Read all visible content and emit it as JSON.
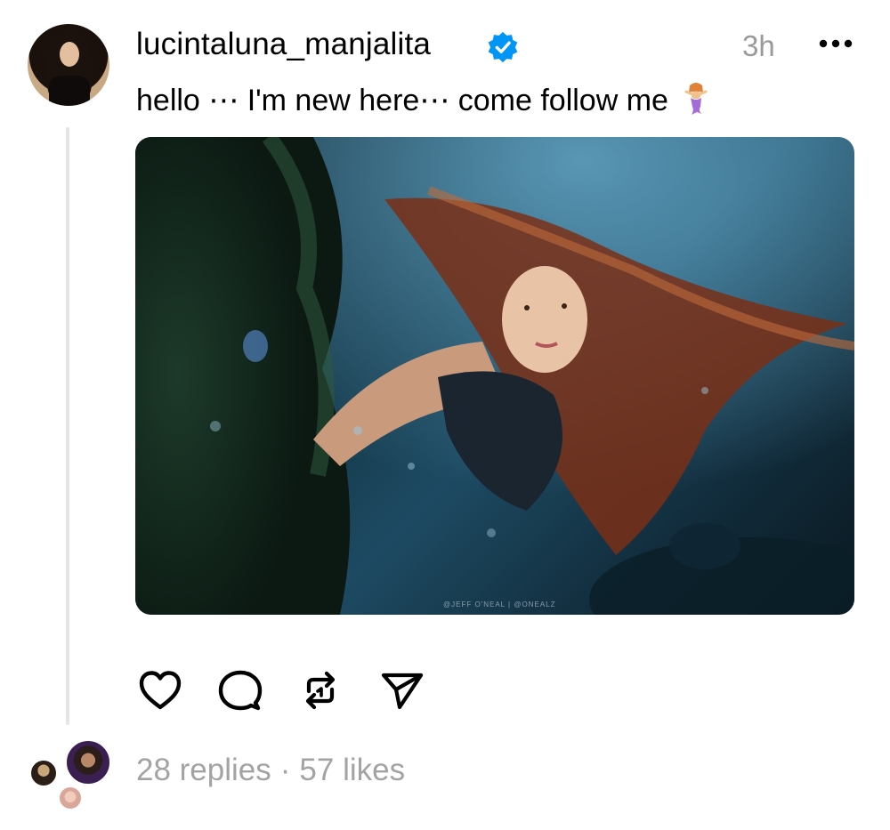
{
  "post": {
    "username": "lucintaluna_manjalita",
    "verified": true,
    "timestamp": "3h",
    "caption": "hello ⋯ I'm new here⋯ come follow me",
    "caption_emoji": "mermaid",
    "photo_watermark": "@JEFF O'NEAL | @ONEALZ"
  },
  "actions": {
    "like_icon": "heart-icon",
    "reply_icon": "comment-bubble-icon",
    "repost_icon": "repost-icon",
    "share_icon": "send-icon"
  },
  "footer": {
    "replies": "28 replies",
    "separator": "·",
    "likes": "57 likes"
  },
  "colors": {
    "verified_badge": "#0095f6",
    "secondary_text": "#9a9a9a",
    "thread_line": "#e5e5e5"
  }
}
